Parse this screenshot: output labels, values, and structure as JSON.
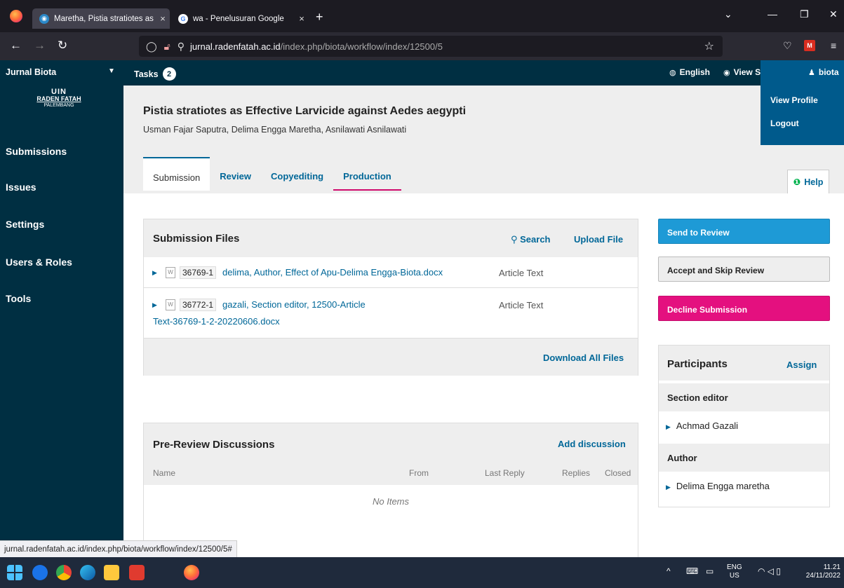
{
  "browser": {
    "tabs": [
      {
        "title": "Maretha, Pistia stratiotes as Effe",
        "close": "×",
        "favicon": "ojs-icon"
      },
      {
        "title": "wa - Penelusuran Google",
        "close": "×",
        "favicon": "google-icon"
      }
    ],
    "new_tab": "+",
    "url_domain": "jurnal.radenfatah.ac.id",
    "url_path": "/index.php/biota/workflow/index/12500/5",
    "status_url": "jurnal.radenfatah.ac.id/index.php/biota/workflow/index/12500/5#"
  },
  "header": {
    "context": "Jurnal Biota",
    "tasks_label": "Tasks",
    "tasks_count": "2",
    "language": "English",
    "view_site": "View Site",
    "user": "biota",
    "user_menu": {
      "profile": "View Profile",
      "logout": "Logout"
    }
  },
  "logo": {
    "line1": "UIN",
    "line2": "RADEN FATAH",
    "line3": "PALEMBANG"
  },
  "sidebar": {
    "items": [
      {
        "label": "Submissions"
      },
      {
        "label": "Issues"
      },
      {
        "label": "Settings"
      },
      {
        "label": "Users & Roles"
      },
      {
        "label": "Tools"
      }
    ]
  },
  "submission": {
    "title": "Pistia stratiotes as Effective Larvicide against Aedes aegypti",
    "authors": "Usman Fajar Saputra, Delima Engga Maretha, Asnilawati Asnilawati"
  },
  "workflow_tabs": [
    {
      "label": "Submission"
    },
    {
      "label": "Review"
    },
    {
      "label": "Copyediting"
    },
    {
      "label": "Production"
    }
  ],
  "help": "Help",
  "files_panel": {
    "title": "Submission Files",
    "search": "Search",
    "upload": "Upload File",
    "download_all": "Download All Files",
    "files": [
      {
        "id": "36769-1",
        "name_1": "delima, Author, Effect of Apu-Delima Engga-Biota.docx",
        "name_2": "",
        "type": "Article Text"
      },
      {
        "id": "36772-1",
        "name_1": "gazali, Section editor, 12500-Article",
        "name_2": "Text-36769-1-2-20220606.docx",
        "type": "Article Text"
      }
    ]
  },
  "discussions_panel": {
    "title": "Pre-Review Discussions",
    "add": "Add discussion",
    "columns": {
      "name": "Name",
      "from": "From",
      "last_reply": "Last Reply",
      "replies": "Replies",
      "closed": "Closed"
    },
    "empty": "No Items"
  },
  "actions": {
    "send_review": "Send to Review",
    "accept_skip": "Accept and Skip Review",
    "decline": "Decline Submission"
  },
  "participants": {
    "title": "Participants",
    "assign": "Assign",
    "groups": [
      {
        "role": "Section editor",
        "name": "Achmad Gazali"
      },
      {
        "role": "Author",
        "name": "Delima Engga maretha"
      }
    ]
  },
  "taskbar": {
    "lang_top": "ENG",
    "lang_bottom": "US",
    "time": "11.21",
    "date": "24/11/2022"
  },
  "colors": {
    "header_bg": "#002f42",
    "link": "#006798",
    "send_review": "#1e9ad6",
    "decline": "#e4107f"
  }
}
